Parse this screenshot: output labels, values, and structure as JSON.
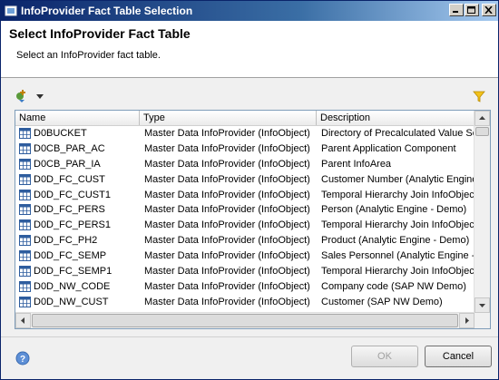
{
  "window": {
    "title": "InfoProvider Fact Table Selection"
  },
  "header": {
    "title": "Select InfoProvider Fact Table",
    "subtitle": "Select an InfoProvider fact table."
  },
  "table": {
    "columns": [
      "Name",
      "Type",
      "Description"
    ],
    "rows": [
      {
        "name": "D0BUCKET",
        "type": "Master Data InfoProvider (InfoObject)",
        "description": "Directory of Precalculated Value Set"
      },
      {
        "name": "D0CB_PAR_AC",
        "type": "Master Data InfoProvider (InfoObject)",
        "description": "Parent Application Component"
      },
      {
        "name": "D0CB_PAR_IA",
        "type": "Master Data InfoProvider (InfoObject)",
        "description": "Parent InfoArea"
      },
      {
        "name": "D0D_FC_CUST",
        "type": "Master Data InfoProvider (InfoObject)",
        "description": "Customer Number (Analytic Engine - "
      },
      {
        "name": "D0D_FC_CUST1",
        "type": "Master Data InfoProvider (InfoObject)",
        "description": "Temporal Hierarchy Join InfoObject"
      },
      {
        "name": "D0D_FC_PERS",
        "type": "Master Data InfoProvider (InfoObject)",
        "description": "Person (Analytic Engine - Demo)"
      },
      {
        "name": "D0D_FC_PERS1",
        "type": "Master Data InfoProvider (InfoObject)",
        "description": "Temporal Hierarchy Join InfoObject"
      },
      {
        "name": "D0D_FC_PH2",
        "type": "Master Data InfoProvider (InfoObject)",
        "description": "Product (Analytic Engine - Demo)"
      },
      {
        "name": "D0D_FC_SEMP",
        "type": "Master Data InfoProvider (InfoObject)",
        "description": "Sales Personnel (Analytic Engine - D"
      },
      {
        "name": "D0D_FC_SEMP1",
        "type": "Master Data InfoProvider (InfoObject)",
        "description": "Temporal Hierarchy Join InfoObject"
      },
      {
        "name": "D0D_NW_CODE",
        "type": "Master Data InfoProvider (InfoObject)",
        "description": "Company code (SAP NW Demo)"
      },
      {
        "name": "D0D_NW_CUST",
        "type": "Master Data InfoProvider (InfoObject)",
        "description": "Customer (SAP NW Demo)"
      }
    ]
  },
  "buttons": {
    "ok": "OK",
    "cancel": "Cancel"
  },
  "icons": {
    "app": "app-icon",
    "add": "add-icon",
    "dropdown": "chevron-down-icon",
    "filter": "filter-icon",
    "row": "table-icon",
    "help": "help-icon"
  }
}
